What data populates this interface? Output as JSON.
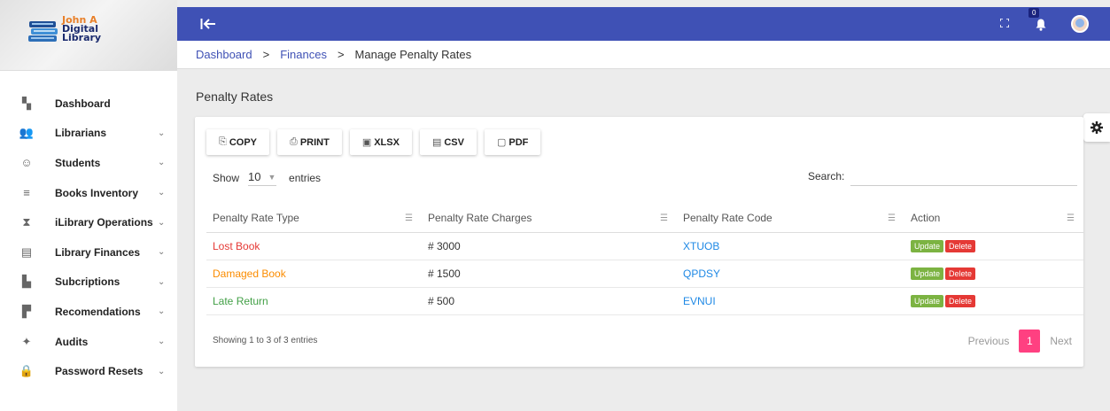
{
  "logo": {
    "line1": "John A",
    "line2": "Digital",
    "line3": "Library"
  },
  "sidebar": {
    "items": [
      {
        "label": "Dashboard",
        "icon": "dashboard-icon",
        "glyph": "▚",
        "has_chevron": false
      },
      {
        "label": "Librarians",
        "icon": "people-icon",
        "glyph": "👥",
        "has_chevron": true
      },
      {
        "label": "Students",
        "icon": "face-icon",
        "glyph": "☺",
        "has_chevron": true
      },
      {
        "label": "Books Inventory",
        "icon": "list-icon",
        "glyph": "≡",
        "has_chevron": true
      },
      {
        "label": "iLibrary Operations",
        "icon": "operations-icon",
        "glyph": "⧗",
        "has_chevron": true
      },
      {
        "label": "Library Finances",
        "icon": "finance-icon",
        "glyph": "▤",
        "has_chevron": true
      },
      {
        "label": "Subcriptions",
        "icon": "subscriptions-icon",
        "glyph": "▙",
        "has_chevron": true
      },
      {
        "label": "Recomendations",
        "icon": "recommendations-icon",
        "glyph": "▛",
        "has_chevron": true
      },
      {
        "label": "Audits",
        "icon": "puzzle-icon",
        "glyph": "✦",
        "has_chevron": true
      },
      {
        "label": "Password Resets",
        "icon": "lock-icon",
        "glyph": "🔒",
        "has_chevron": true
      }
    ]
  },
  "topbar": {
    "notification_count": "0",
    "accent": "#3f51b5"
  },
  "breadcrumb": {
    "items": [
      "Dashboard",
      "Finances"
    ],
    "current": "Manage Penalty Rates",
    "separator": ">"
  },
  "page": {
    "title": "Penalty Rates"
  },
  "toolbar": {
    "buttons": [
      {
        "label": "COPY",
        "icon": "copy-icon",
        "glyph": "⎘"
      },
      {
        "label": "PRINT",
        "icon": "print-icon",
        "glyph": "⎙"
      },
      {
        "label": "XLSX",
        "icon": "xlsx-icon",
        "glyph": "▣"
      },
      {
        "label": "CSV",
        "icon": "csv-icon",
        "glyph": "▤"
      },
      {
        "label": "PDF",
        "icon": "pdf-icon",
        "glyph": "▢"
      }
    ]
  },
  "length": {
    "prefix": "Show",
    "value": "10",
    "suffix": "entries"
  },
  "search": {
    "label": "Search:",
    "value": "",
    "placeholder": ""
  },
  "table": {
    "headers": [
      "Penalty Rate Type",
      "Penalty Rate Charges",
      "Penalty Rate Code",
      "Action"
    ],
    "rows": [
      {
        "type": "Lost Book",
        "charges": "# 3000",
        "code": "XTUOB"
      },
      {
        "type": "Damaged Book",
        "charges": "# 1500",
        "code": "QPDSY"
      },
      {
        "type": "Late Return",
        "charges": "# 500",
        "code": "EVNUI"
      }
    ],
    "update_label": "Update",
    "delete_label": "Delete"
  },
  "footer": {
    "info": "Showing 1 to 3 of 3 entries",
    "previous": "Previous",
    "page": "1",
    "next": "Next"
  }
}
